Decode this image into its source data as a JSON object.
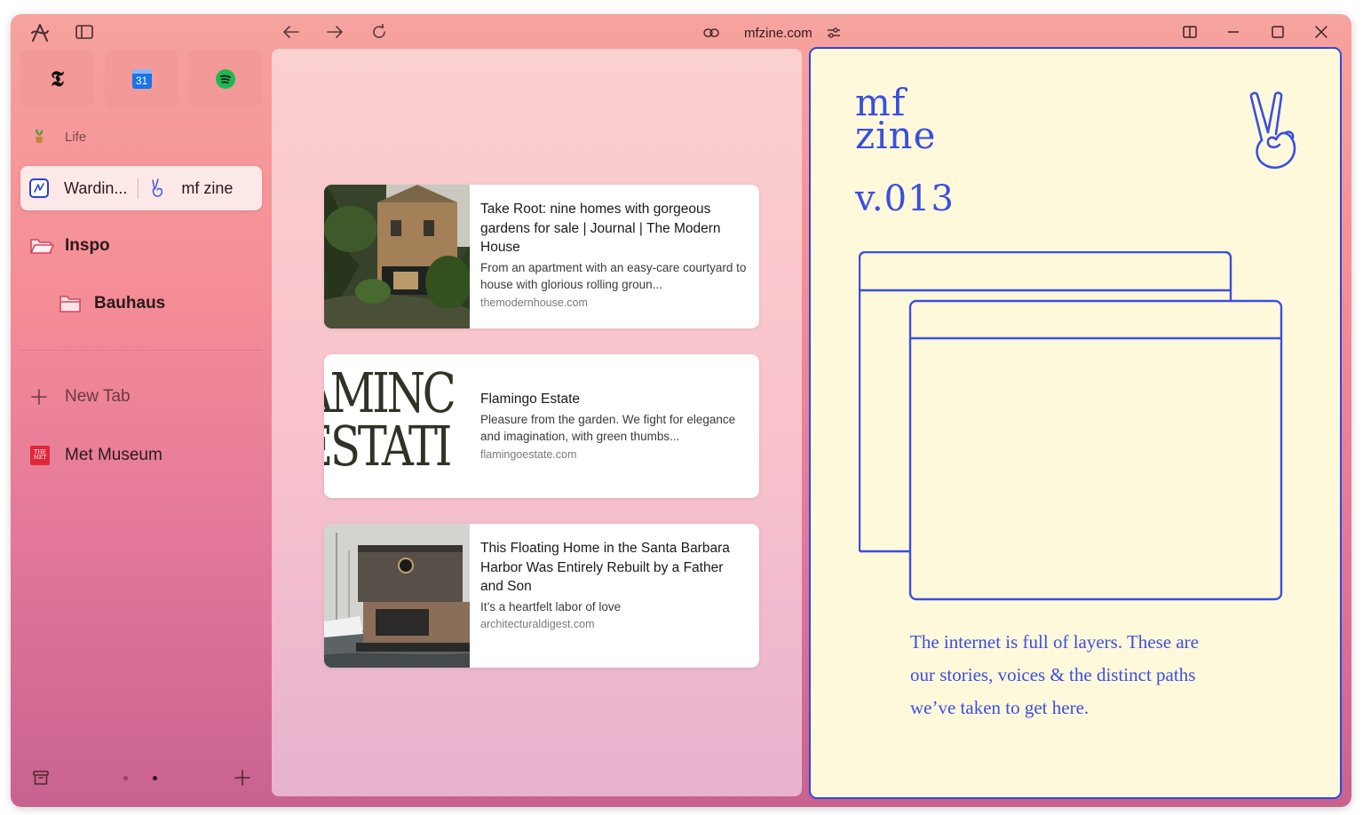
{
  "browser": {
    "url": "mfzine.com",
    "icons": {
      "app": "arc-logo-icon",
      "sidebar_toggle": "sidebar-toggle-icon",
      "back": "arrow-left-icon",
      "forward": "arrow-right-icon",
      "reload": "reload-icon",
      "link": "link-icon",
      "site_controls": "sliders-icon",
      "split_view": "split-view-icon",
      "minimize": "minimize-icon",
      "maximize": "maximize-icon",
      "close": "close-icon"
    }
  },
  "sidebar": {
    "pinned": [
      {
        "name": "nytimes",
        "icon": "nyt-logo-icon"
      },
      {
        "name": "calendar",
        "icon": "calendar-icon",
        "badge": "31"
      },
      {
        "name": "spotify",
        "icon": "spotify-icon"
      }
    ],
    "space_label": "Life",
    "split_tab": {
      "left": "Wardin...",
      "right": "mf zine"
    },
    "folders": [
      {
        "label": "Inspo"
      },
      {
        "label": "Bauhaus"
      }
    ],
    "new_tab": "New Tab",
    "tabs": [
      {
        "label": "Met Museum",
        "icon_text": "THE MET"
      }
    ]
  },
  "cards": [
    {
      "title": "Take Root: nine homes with gorgeous gardens for sale | Journal | The Modern House",
      "description": "From an apartment with an easy-care courtyard to house with glorious rolling groun...",
      "source": "themodernhouse.com"
    },
    {
      "title": "Flamingo Estate",
      "description": "Pleasure from the garden. We fight for elegance and imagination, with green thumbs...",
      "source": "flamingoestate.com",
      "thumb_text": [
        "AMINC",
        "ESTATI"
      ]
    },
    {
      "title": "This Floating Home in the Santa Barbara Harbor Was Entirely Rebuilt by a Father and Son",
      "description": "It’s a heartfelt labor of love",
      "source": "architecturaldigest.com"
    }
  ],
  "zine": {
    "logo_line1": "mf",
    "logo_line2": "zine",
    "version": "v.013",
    "copy": "The internet is full of layers. These are our stories, voices & the distinct paths we’ve taken to get here."
  },
  "colors": {
    "accent_blue": "#3a4fe0",
    "zine_background": "#fff9dc"
  }
}
